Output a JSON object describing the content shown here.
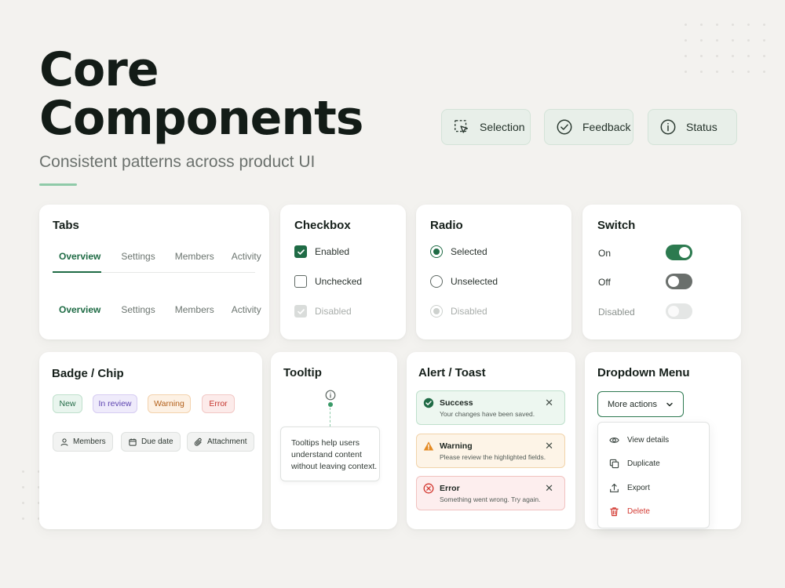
{
  "header": {
    "title": "Core\nComponents",
    "subtitle": "Consistent patterns across product UI"
  },
  "categories": [
    {
      "label": "Selection",
      "icon": "selection-cursor-icon"
    },
    {
      "label": "Feedback",
      "icon": "check-circle-icon"
    },
    {
      "label": "Status",
      "icon": "info-circle-icon"
    }
  ],
  "tabs": {
    "title": "Tabs",
    "row1": [
      "Overview",
      "Settings",
      "Members",
      "Activity"
    ],
    "row2": [
      "Overview",
      "Settings",
      "Members",
      "Activity"
    ]
  },
  "checkbox": {
    "title": "Checkbox",
    "enabled": "Enabled",
    "unchecked": "Unchecked",
    "disabled": "Disabled"
  },
  "radio": {
    "title": "Radio",
    "selected": "Selected",
    "unselected": "Unselected",
    "disabled": "Disabled"
  },
  "switch": {
    "title": "Switch",
    "on": "On",
    "off": "Off",
    "disabled": "Disabled"
  },
  "badges": {
    "title": "Badge / Chip",
    "items": [
      "New",
      "In review",
      "Warning",
      "Error"
    ],
    "chips": [
      {
        "label": "Members",
        "icon": "user-icon"
      },
      {
        "label": "Due date",
        "icon": "calendar-icon"
      },
      {
        "label": "Attachment",
        "icon": "paperclip-icon"
      }
    ]
  },
  "tooltip": {
    "title": "Tooltip",
    "line1": "Tooltips help users",
    "line2": "understand content",
    "line3": "without leaving context."
  },
  "alerts": {
    "title": "Alert / Toast",
    "success": {
      "title": "Success",
      "body": "Your changes have been saved."
    },
    "warning": {
      "title": "Warning",
      "body": "Please review the highlighted fields."
    },
    "error": {
      "title": "Error",
      "body": "Something went wrong. Try again."
    },
    "close_glyph": "✕"
  },
  "dropdown": {
    "title": "Dropdown Menu",
    "trigger": "More actions",
    "items": [
      "View details",
      "Duplicate",
      "Export",
      "Delete"
    ]
  },
  "colors": {
    "accent": "#1f6b45",
    "success_bg": "#edf7f0",
    "warning_bg": "#fdf4e7",
    "error_bg": "#fdeeee",
    "danger": "#d33a32"
  }
}
